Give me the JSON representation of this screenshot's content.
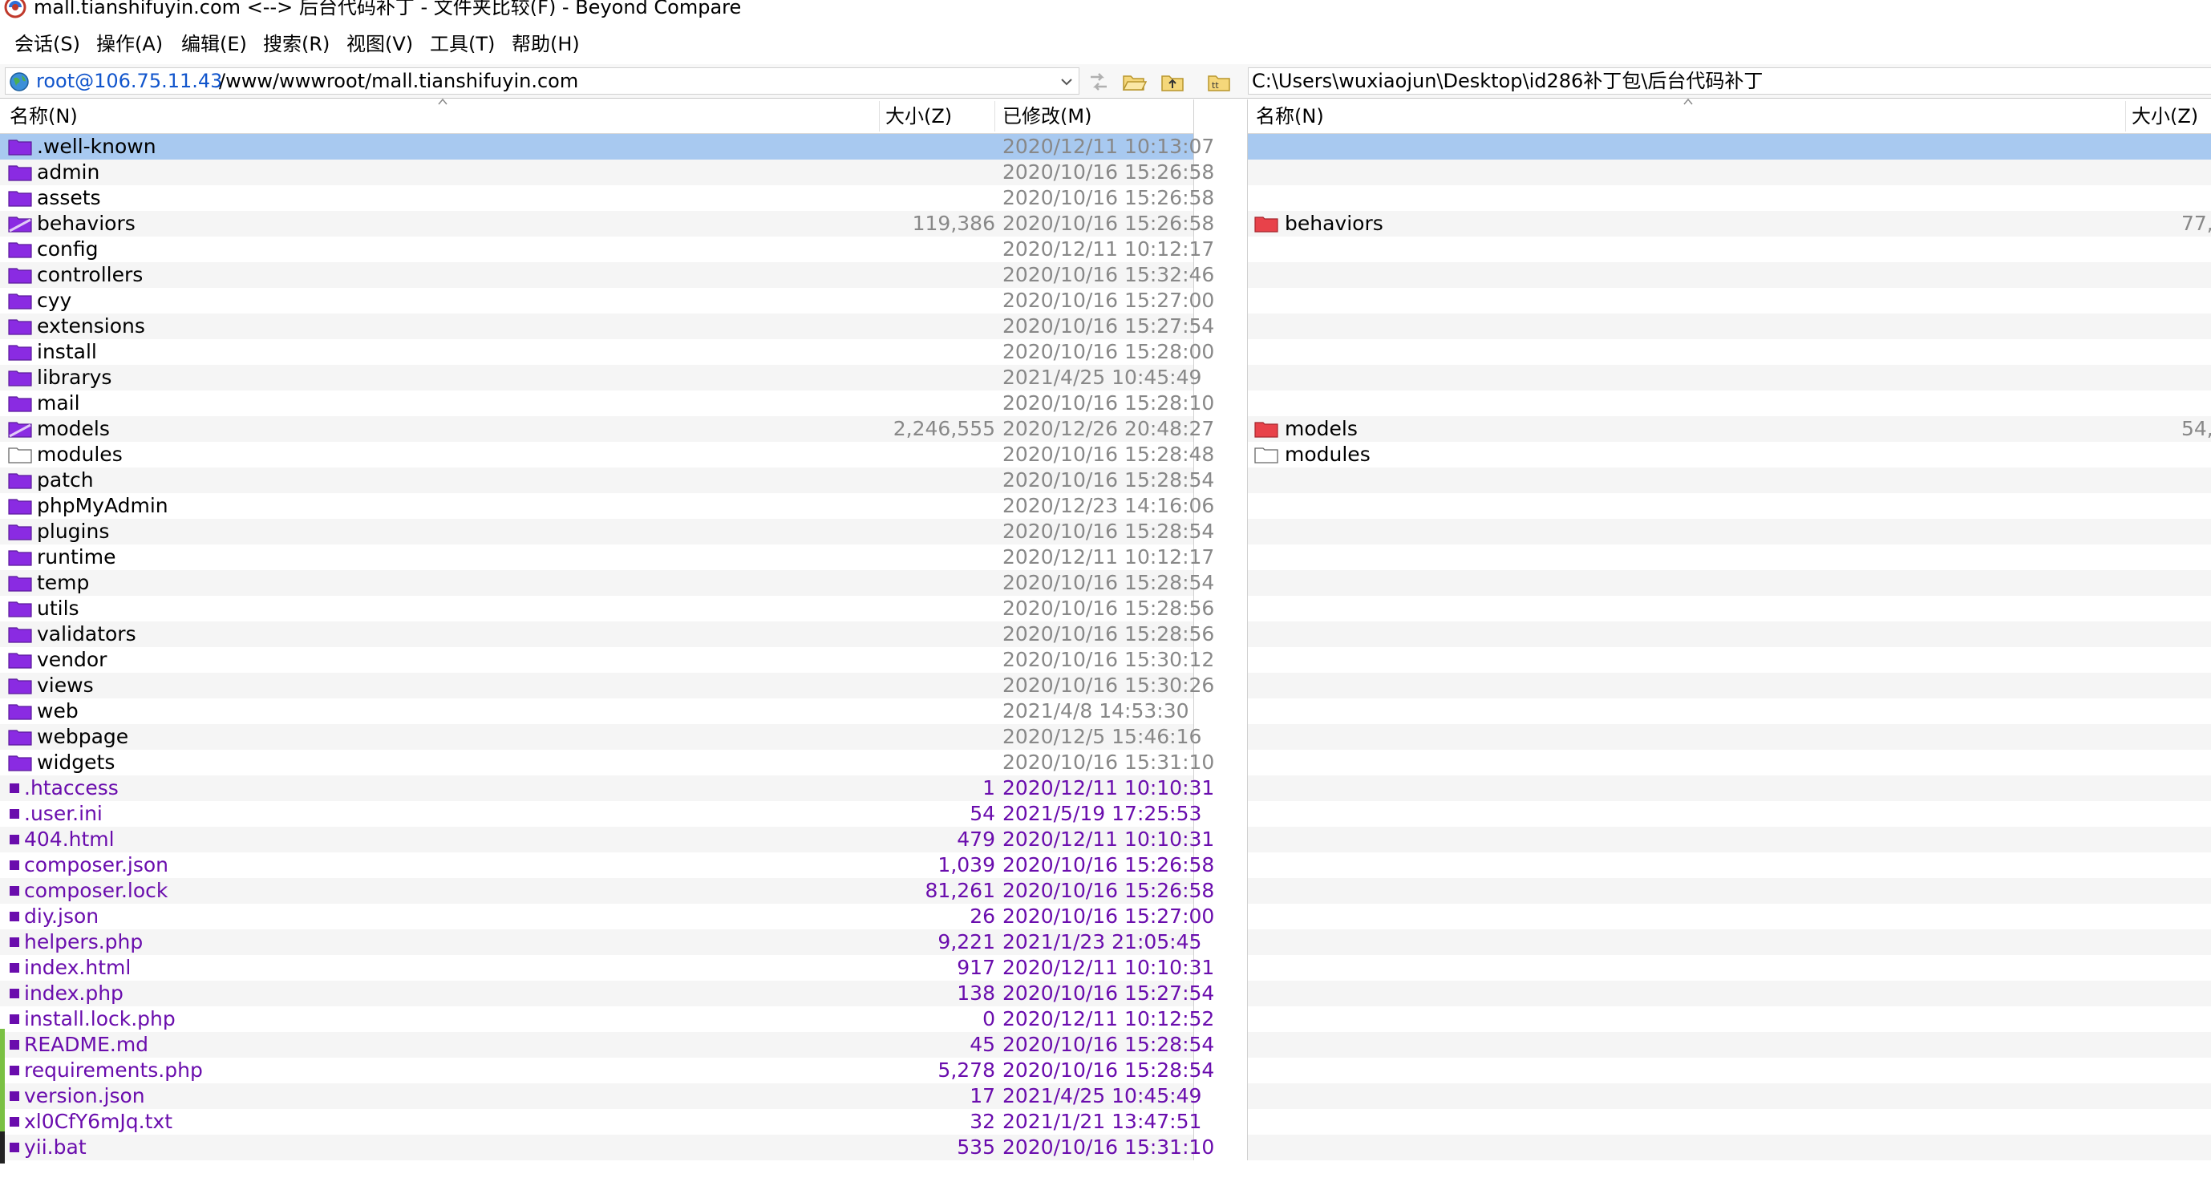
{
  "window": {
    "title": "mall.tianshifuyin.com <--> 后台代码补丁 - 文件夹比较(F) - Beyond Compare"
  },
  "menu": [
    "会话(S)",
    "操作(A)",
    "编辑(E)",
    "搜索(R)",
    "视图(V)",
    "工具(T)",
    "帮助(H)"
  ],
  "left_path": {
    "host": "root@106.75.11.43",
    "dir": "/www/wwwroot/mall.tianshifuyin.com"
  },
  "right_path": {
    "text": "C:\\Users\\wuxiaojun\\Desktop\\id286补丁包\\后台代码补丁"
  },
  "left_headers": {
    "name": "名称(N)",
    "size": "大小(Z)",
    "modified": "已修改(M)"
  },
  "right_headers": {
    "name": "名称(N)",
    "size": "大小(Z)"
  },
  "colors": {
    "selection": "#a8c9f0",
    "folder_purple": "#8a2be2",
    "folder_red": "#e8424a",
    "file_purple": "#6a0dad",
    "orphan_green": "#7ac143"
  },
  "left_rows": [
    {
      "name": ".well-known",
      "kind": "folder",
      "size": "",
      "modified": "2020/12/11 10:13:07",
      "color": "gray"
    },
    {
      "name": "admin",
      "kind": "folder",
      "size": "",
      "modified": "2020/10/16 15:26:58",
      "color": "gray"
    },
    {
      "name": "assets",
      "kind": "folder",
      "size": "",
      "modified": "2020/10/16 15:26:58",
      "color": "gray"
    },
    {
      "name": "behaviors",
      "kind": "folder-diff",
      "size": "119,386",
      "modified": "2020/10/16 15:26:58",
      "color": "gray"
    },
    {
      "name": "config",
      "kind": "folder",
      "size": "",
      "modified": "2020/12/11 10:12:17",
      "color": "gray"
    },
    {
      "name": "controllers",
      "kind": "folder",
      "size": "",
      "modified": "2020/10/16 15:32:46",
      "color": "gray"
    },
    {
      "name": "cyy",
      "kind": "folder",
      "size": "",
      "modified": "2020/10/16 15:27:00",
      "color": "gray"
    },
    {
      "name": "extensions",
      "kind": "folder",
      "size": "",
      "modified": "2020/10/16 15:27:54",
      "color": "gray"
    },
    {
      "name": "install",
      "kind": "folder",
      "size": "",
      "modified": "2020/10/16 15:28:00",
      "color": "gray"
    },
    {
      "name": "librarys",
      "kind": "folder",
      "size": "",
      "modified": "2021/4/25 10:45:49",
      "color": "gray"
    },
    {
      "name": "mail",
      "kind": "folder",
      "size": "",
      "modified": "2020/10/16 15:28:10",
      "color": "gray"
    },
    {
      "name": "models",
      "kind": "folder-diff",
      "size": "2,246,555",
      "modified": "2020/12/26 20:48:27",
      "color": "gray"
    },
    {
      "name": "modules",
      "kind": "folder-empty",
      "size": "",
      "modified": "2020/10/16 15:28:48",
      "color": "gray"
    },
    {
      "name": "patch",
      "kind": "folder",
      "size": "",
      "modified": "2020/10/16 15:28:54",
      "color": "gray"
    },
    {
      "name": "phpMyAdmin",
      "kind": "folder",
      "size": "",
      "modified": "2020/12/23 14:16:06",
      "color": "gray"
    },
    {
      "name": "plugins",
      "kind": "folder",
      "size": "",
      "modified": "2020/10/16 15:28:54",
      "color": "gray"
    },
    {
      "name": "runtime",
      "kind": "folder",
      "size": "",
      "modified": "2020/12/11 10:12:17",
      "color": "gray"
    },
    {
      "name": "temp",
      "kind": "folder",
      "size": "",
      "modified": "2020/10/16 15:28:54",
      "color": "gray"
    },
    {
      "name": "utils",
      "kind": "folder",
      "size": "",
      "modified": "2020/10/16 15:28:56",
      "color": "gray"
    },
    {
      "name": "validators",
      "kind": "folder",
      "size": "",
      "modified": "2020/10/16 15:28:56",
      "color": "gray"
    },
    {
      "name": "vendor",
      "kind": "folder",
      "size": "",
      "modified": "2020/10/16 15:30:12",
      "color": "gray"
    },
    {
      "name": "views",
      "kind": "folder",
      "size": "",
      "modified": "2020/10/16 15:30:26",
      "color": "gray"
    },
    {
      "name": "web",
      "kind": "folder",
      "size": "",
      "modified": "2021/4/8 14:53:30",
      "color": "gray"
    },
    {
      "name": "webpage",
      "kind": "folder",
      "size": "",
      "modified": "2020/12/5 15:46:16",
      "color": "gray"
    },
    {
      "name": "widgets",
      "kind": "folder",
      "size": "",
      "modified": "2020/10/16 15:31:10",
      "color": "gray"
    },
    {
      "name": ".htaccess",
      "kind": "file",
      "size": "1",
      "modified": "2020/12/11 10:10:31",
      "color": "purple"
    },
    {
      "name": ".user.ini",
      "kind": "file",
      "size": "54",
      "modified": "2021/5/19 17:25:53",
      "color": "purple"
    },
    {
      "name": "404.html",
      "kind": "file",
      "size": "479",
      "modified": "2020/12/11 10:10:31",
      "color": "purple"
    },
    {
      "name": "composer.json",
      "kind": "file",
      "size": "1,039",
      "modified": "2020/10/16 15:26:58",
      "color": "purple"
    },
    {
      "name": "composer.lock",
      "kind": "file",
      "size": "81,261",
      "modified": "2020/10/16 15:26:58",
      "color": "purple"
    },
    {
      "name": "diy.json",
      "kind": "file",
      "size": "26",
      "modified": "2020/10/16 15:27:00",
      "color": "purple"
    },
    {
      "name": "helpers.php",
      "kind": "file",
      "size": "9,221",
      "modified": "2021/1/23 21:05:45",
      "color": "purple"
    },
    {
      "name": "index.html",
      "kind": "file",
      "size": "917",
      "modified": "2020/12/11 10:10:31",
      "color": "purple"
    },
    {
      "name": "index.php",
      "kind": "file",
      "size": "138",
      "modified": "2020/10/16 15:27:54",
      "color": "purple"
    },
    {
      "name": "install.lock.php",
      "kind": "file",
      "size": "0",
      "modified": "2020/12/11 10:12:52",
      "color": "purple"
    },
    {
      "name": "README.md",
      "kind": "file",
      "size": "45",
      "modified": "2020/10/16 15:28:54",
      "color": "purple"
    },
    {
      "name": "requirements.php",
      "kind": "file",
      "size": "5,278",
      "modified": "2020/10/16 15:28:54",
      "color": "purple"
    },
    {
      "name": "version.json",
      "kind": "file",
      "size": "17",
      "modified": "2021/4/25 10:45:49",
      "color": "purple"
    },
    {
      "name": "xl0CfY6mJq.txt",
      "kind": "file",
      "size": "32",
      "modified": "2021/1/21 13:47:51",
      "color": "purple"
    },
    {
      "name": "yii.bat",
      "kind": "file",
      "size": "535",
      "modified": "2020/10/16 15:31:10",
      "color": "purple"
    }
  ],
  "right_rows": [
    {
      "row": 3,
      "name": "behaviors",
      "kind": "folder-red",
      "size": "77,"
    },
    {
      "row": 11,
      "name": "models",
      "kind": "folder-red",
      "size": "54,"
    },
    {
      "row": 12,
      "name": "modules",
      "kind": "folder-empty",
      "size": ""
    }
  ]
}
